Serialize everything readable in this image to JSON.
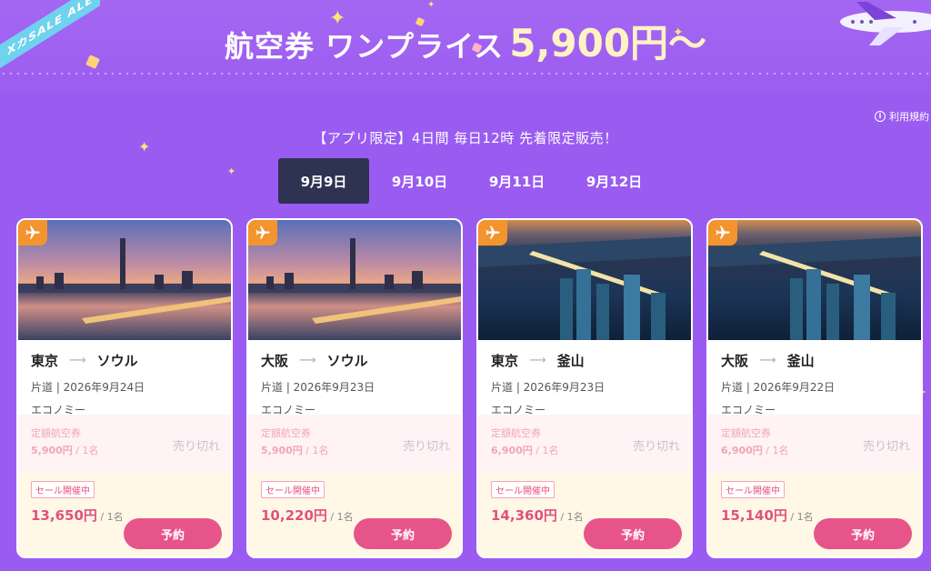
{
  "banner": {
    "title_main": "航空券 ワンプライス",
    "title_price": "5,900円〜",
    "ribbon_text": "XカSALE ALE"
  },
  "terms": {
    "label": "利用規約",
    "icon": "info-icon"
  },
  "promo_text": "【アプリ限定】4日間 毎日12時 先着限定販売！",
  "tabs": [
    {
      "label": "9月9日",
      "active": true
    },
    {
      "label": "9月10日",
      "active": false
    },
    {
      "label": "9月11日",
      "active": false
    },
    {
      "label": "9月12日",
      "active": false
    }
  ],
  "cards": [
    {
      "image": "seoul-skyline-photo",
      "from": "東京",
      "to": "ソウル",
      "trip": "片道 | 2026年9月24日",
      "cabin": "エコノミー",
      "fixed_label": "定額航空券",
      "fixed_price": "5,900円",
      "fixed_per": " / 1名",
      "soldout": "売り切れ",
      "sale_tag": "セール開催中",
      "sale_price": "13,650円",
      "sale_per": " / 1名",
      "book": "予約"
    },
    {
      "image": "seoul-skyline-photo",
      "from": "大阪",
      "to": "ソウル",
      "trip": "片道 | 2026年9月23日",
      "cabin": "エコノミー",
      "fixed_label": "定額航空券",
      "fixed_price": "5,900円",
      "fixed_per": " / 1名",
      "soldout": "売り切れ",
      "sale_tag": "セール開催中",
      "sale_price": "10,220円",
      "sale_per": " / 1名",
      "book": "予約"
    },
    {
      "image": "busan-night-photo",
      "from": "東京",
      "to": "釜山",
      "trip": "片道 | 2026年9月23日",
      "cabin": "エコノミー",
      "fixed_label": "定額航空券",
      "fixed_price": "6,900円",
      "fixed_per": " / 1名",
      "soldout": "売り切れ",
      "sale_tag": "セール開催中",
      "sale_price": "14,360円",
      "sale_per": " / 1名",
      "book": "予約"
    },
    {
      "image": "busan-night-photo",
      "from": "大阪",
      "to": "釜山",
      "trip": "片道 | 2026年9月22日",
      "cabin": "エコノミー",
      "fixed_label": "定額航空券",
      "fixed_price": "6,900円",
      "fixed_per": " / 1名",
      "soldout": "売り切れ",
      "sale_tag": "セール開催中",
      "sale_price": "15,140円",
      "sale_per": " / 1名",
      "book": "予約"
    }
  ],
  "colors": {
    "background": "#9a5cf0",
    "active_tab": "#2f3352",
    "book_button": "#e7548a",
    "badge": "#f3942e",
    "sale_price": "#e2517f"
  }
}
